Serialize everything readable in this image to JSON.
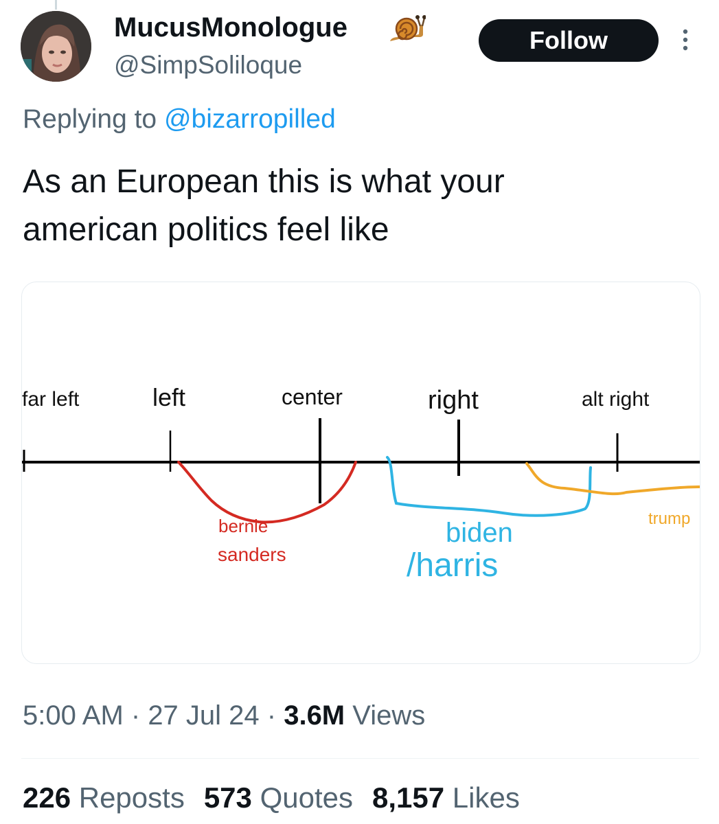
{
  "author": {
    "display_name": "MucusMonologue",
    "badge_icon": "snail-icon",
    "handle": "@SimpSoliloque"
  },
  "follow_label": "Follow",
  "reply": {
    "prefix": "Replying to ",
    "mention": "@bizarropilled"
  },
  "tweet_text": "As an European this is what your\namerican politics feel like",
  "image": {
    "axis_labels": [
      "far left",
      "left",
      "center",
      "right",
      "alt right"
    ],
    "annotations": {
      "sanders_line1": "bernie",
      "sanders_line2": "sanders",
      "biden_line1": "biden",
      "biden_line2": "/harris",
      "trump": "trump"
    },
    "colors": {
      "sanders": "#d42a22",
      "biden": "#2fb4e3",
      "trump": "#f0a82a"
    }
  },
  "meta": {
    "time": "5:00 AM",
    "sep1": " · ",
    "date": "27 Jul 24",
    "sep2": " · ",
    "views_count": "3.6M",
    "views_label": " Views"
  },
  "stats": {
    "reposts_count": "226",
    "reposts_label": " Reposts",
    "quotes_count": "573",
    "quotes_label": " Quotes",
    "likes_count": "8,157",
    "likes_label": " Likes"
  }
}
